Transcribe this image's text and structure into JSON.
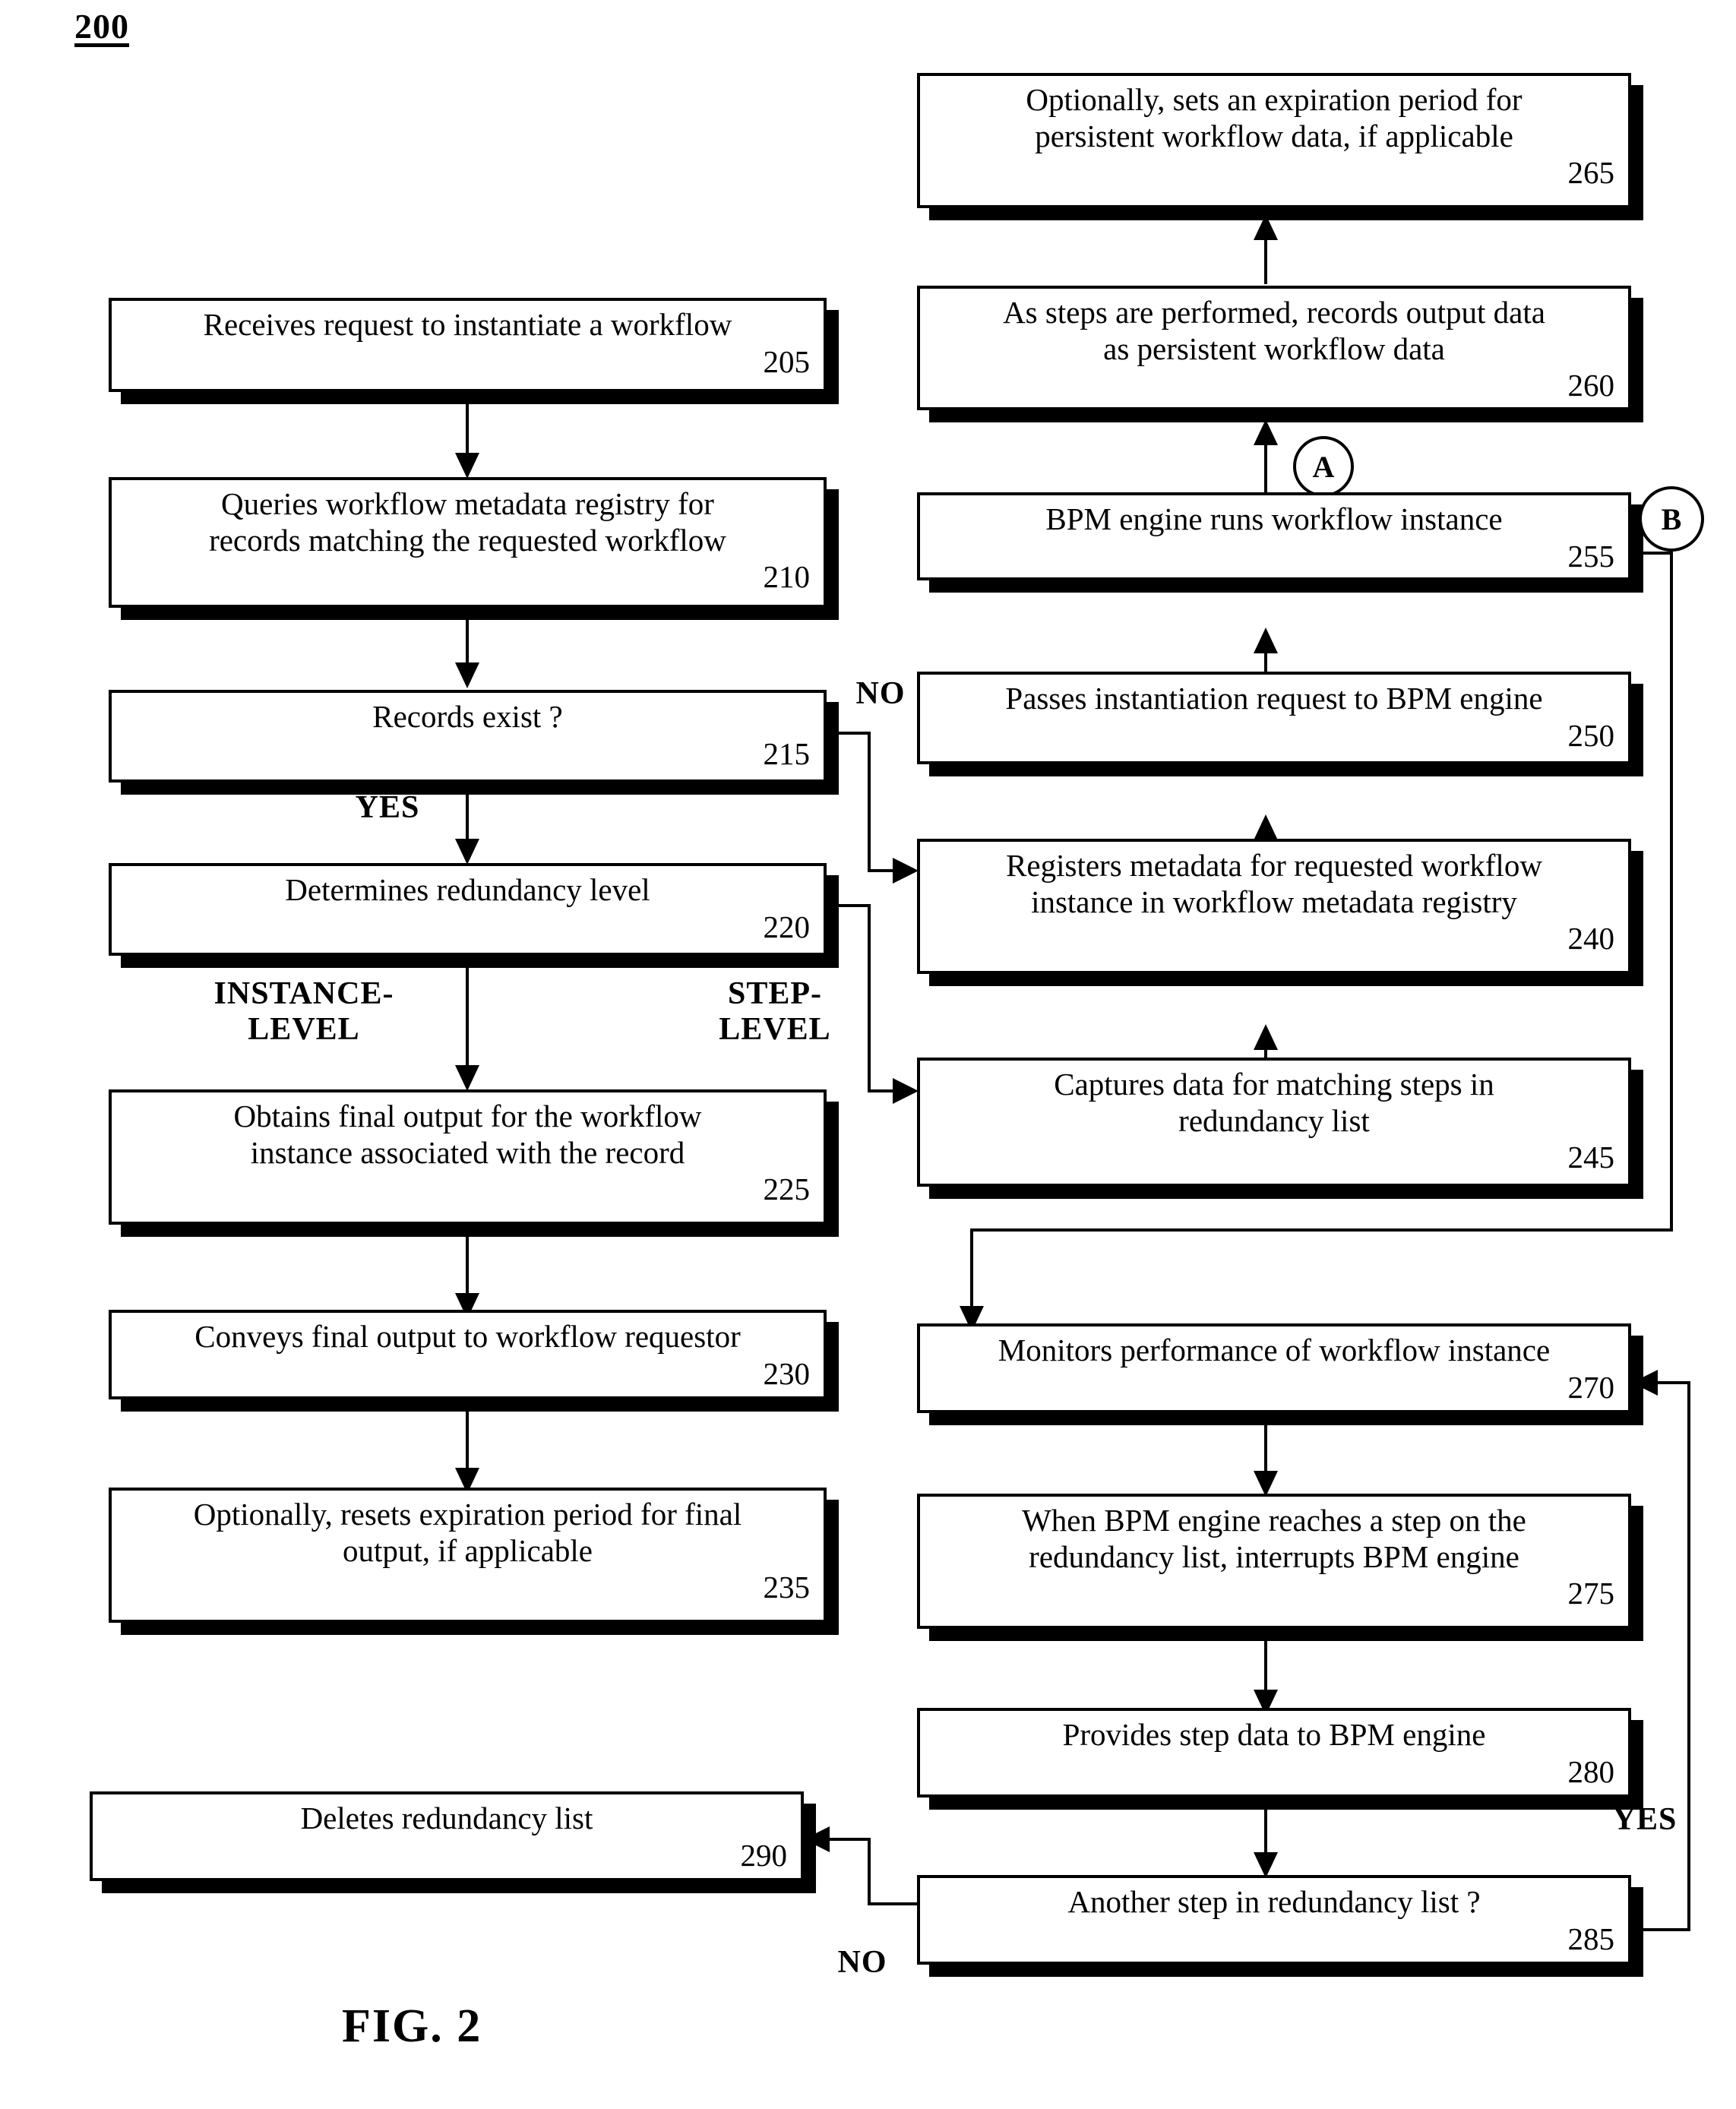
{
  "figure": {
    "number_label": "200",
    "caption": "FIG. 2"
  },
  "nodes": [
    {
      "id": "205",
      "ref": "205",
      "text": "Receives request to instantiate a workflow"
    },
    {
      "id": "210",
      "ref": "210",
      "text": "Queries workflow metadata registry for\nrecords matching the requested workflow"
    },
    {
      "id": "215",
      "ref": "215",
      "text": "Records exist ?"
    },
    {
      "id": "220",
      "ref": "220",
      "text": "Determines redundancy level"
    },
    {
      "id": "225",
      "ref": "225",
      "text": "Obtains final output for the workflow\ninstance associated with the record"
    },
    {
      "id": "230",
      "ref": "230",
      "text": "Conveys final output to workflow requestor"
    },
    {
      "id": "235",
      "ref": "235",
      "text": "Optionally, resets expiration period for final\noutput, if applicable"
    },
    {
      "id": "240",
      "ref": "240",
      "text": "Registers metadata for requested workflow\ninstance in workflow metadata registry"
    },
    {
      "id": "245",
      "ref": "245",
      "text": "Captures data for matching steps in\nredundancy list"
    },
    {
      "id": "250",
      "ref": "250",
      "text": "Passes instantiation request to BPM engine"
    },
    {
      "id": "255",
      "ref": "255",
      "text": "BPM engine runs workflow instance"
    },
    {
      "id": "260",
      "ref": "260",
      "text": "As steps are performed, records output data\nas persistent workflow data"
    },
    {
      "id": "265",
      "ref": "265",
      "text": "Optionally, sets an expiration period for\npersistent workflow data, if applicable"
    },
    {
      "id": "270",
      "ref": "270",
      "text": "Monitors performance of workflow instance"
    },
    {
      "id": "275",
      "ref": "275",
      "text": "When BPM engine reaches a step on the\nredundancy list, interrupts BPM engine"
    },
    {
      "id": "280",
      "ref": "280",
      "text": "Provides step data to BPM engine"
    },
    {
      "id": "285",
      "ref": "285",
      "text": "Another step in redundancy list ?"
    },
    {
      "id": "290",
      "ref": "290",
      "text": "Deletes redundancy list"
    }
  ],
  "branch_labels": {
    "no_215": "NO",
    "yes_215": "YES",
    "instance_level_220": "INSTANCE-\nLEVEL",
    "step_level_220": "STEP-\nLEVEL",
    "yes_285": "YES",
    "no_285": "NO"
  },
  "connectors": {
    "a": "A",
    "b": "B"
  }
}
